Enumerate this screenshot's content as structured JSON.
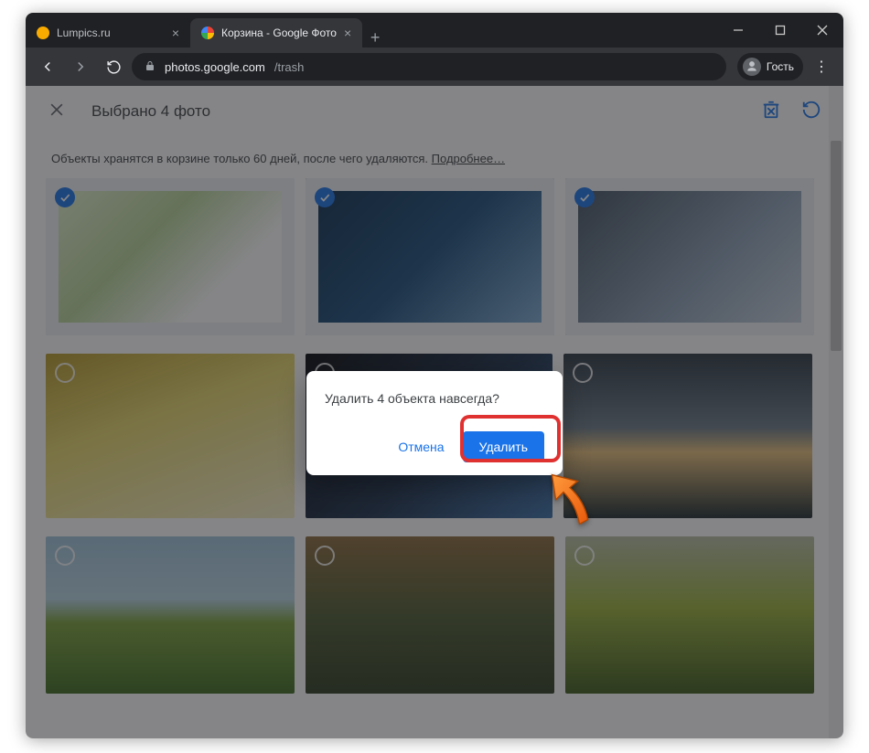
{
  "window": {
    "tabs": [
      {
        "title": "Lumpics.ru",
        "active": false
      },
      {
        "title": "Корзина - Google Фото",
        "active": true
      }
    ],
    "profile_label": "Гость"
  },
  "address": {
    "host": "photos.google.com",
    "path": "/trash"
  },
  "appbar": {
    "title": "Выбрано 4 фото"
  },
  "info": {
    "text": "Объекты хранятся в корзине только 60 дней, после чего удаляются. ",
    "link": "Подробнее…"
  },
  "photos": [
    {
      "selected": true
    },
    {
      "selected": true
    },
    {
      "selected": true
    },
    {
      "selected": false
    },
    {
      "selected": false
    },
    {
      "selected": false
    },
    {
      "selected": false
    },
    {
      "selected": false
    },
    {
      "selected": false
    }
  ],
  "dialog": {
    "message": "Удалить 4 объекта навсегда?",
    "cancel": "Отмена",
    "confirm": "Удалить"
  }
}
